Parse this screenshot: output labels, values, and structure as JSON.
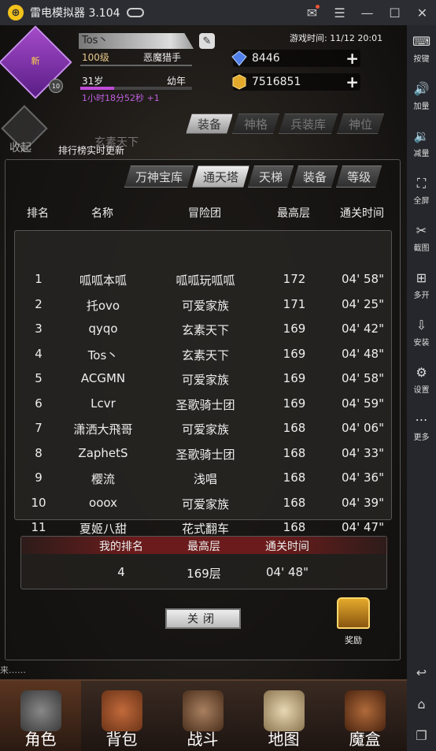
{
  "window": {
    "title": "雷电模拟器 3.104"
  },
  "sidebar": {
    "items": [
      {
        "icon": "keyboard-icon",
        "label": "按键"
      },
      {
        "icon": "volume-up-icon",
        "label": "加量"
      },
      {
        "icon": "volume-down-icon",
        "label": "减量"
      },
      {
        "icon": "fullscreen-icon",
        "label": "全屏"
      },
      {
        "icon": "scissors-icon",
        "label": "截图"
      },
      {
        "icon": "multi-open-icon",
        "label": "多开"
      },
      {
        "icon": "apk-install-icon",
        "label": "安装"
      },
      {
        "icon": "gear-icon",
        "label": "设置"
      },
      {
        "icon": "more-icon",
        "label": "更多"
      }
    ]
  },
  "player": {
    "avatar_text": "新",
    "level_badge": "10",
    "name": "Tos丶",
    "level": "100级",
    "class": "恶魔猎手",
    "age": "31岁",
    "age_stage": "幼年",
    "age_progress": 0.3,
    "timer": "1小时18分52秒 +1",
    "game_time": "游戏时间: 11/12 20:01",
    "diamonds": "8446",
    "gold": "7516851"
  },
  "hud": {
    "collapse": "收起",
    "rank_note": "排行榜实时更新",
    "faded_text": "玄素天下",
    "top_tabs": [
      "装备",
      "神格",
      "兵装库",
      "神位"
    ]
  },
  "ranking": {
    "tabs": [
      "万神宝库",
      "通天塔",
      "天梯",
      "装备",
      "等级"
    ],
    "active_tab": 1,
    "headers": {
      "rank": "排名",
      "name": "名称",
      "guild": "冒险团",
      "floor": "最高层",
      "time": "通关时间"
    },
    "rows": [
      {
        "rank": "1",
        "name": "呱呱本呱",
        "guild": "呱呱玩呱呱",
        "floor": "172",
        "time": "04' 58\""
      },
      {
        "rank": "2",
        "name": "托ovo",
        "guild": "可爱家族",
        "floor": "171",
        "time": "04' 25\""
      },
      {
        "rank": "3",
        "name": "qyqo",
        "guild": "玄素天下",
        "floor": "169",
        "time": "04' 42\""
      },
      {
        "rank": "4",
        "name": "Tos丶",
        "guild": "玄素天下",
        "floor": "169",
        "time": "04' 48\""
      },
      {
        "rank": "5",
        "name": "ACGMN",
        "guild": "可爱家族",
        "floor": "169",
        "time": "04' 58\""
      },
      {
        "rank": "6",
        "name": "Lcvr",
        "guild": "圣歌骑士团",
        "floor": "169",
        "time": "04' 59\""
      },
      {
        "rank": "7",
        "name": "潇洒大飛哥",
        "guild": "可爱家族",
        "floor": "168",
        "time": "04' 06\""
      },
      {
        "rank": "8",
        "name": "ZaphetS",
        "guild": "圣歌骑士团",
        "floor": "168",
        "time": "04' 33\""
      },
      {
        "rank": "9",
        "name": "樱流",
        "guild": "浅唱",
        "floor": "168",
        "time": "04' 36\""
      },
      {
        "rank": "10",
        "name": "ooox",
        "guild": "可爱家族",
        "floor": "168",
        "time": "04' 39\""
      },
      {
        "rank": "11",
        "name": "夏姬八甜",
        "guild": "花式翻车",
        "floor": "168",
        "time": "04' 47\""
      }
    ],
    "mine": {
      "rank_label": "我的排名",
      "floor_label": "最高层",
      "time_label": "通关时间",
      "rank": "4",
      "floor": "169层",
      "time": "04' 48\""
    },
    "close_label": "关闭",
    "reward_label": "奖励",
    "ticker": "来……"
  },
  "bottom_nav": [
    "角色",
    "背包",
    "战斗",
    "地图",
    "魔盒"
  ]
}
